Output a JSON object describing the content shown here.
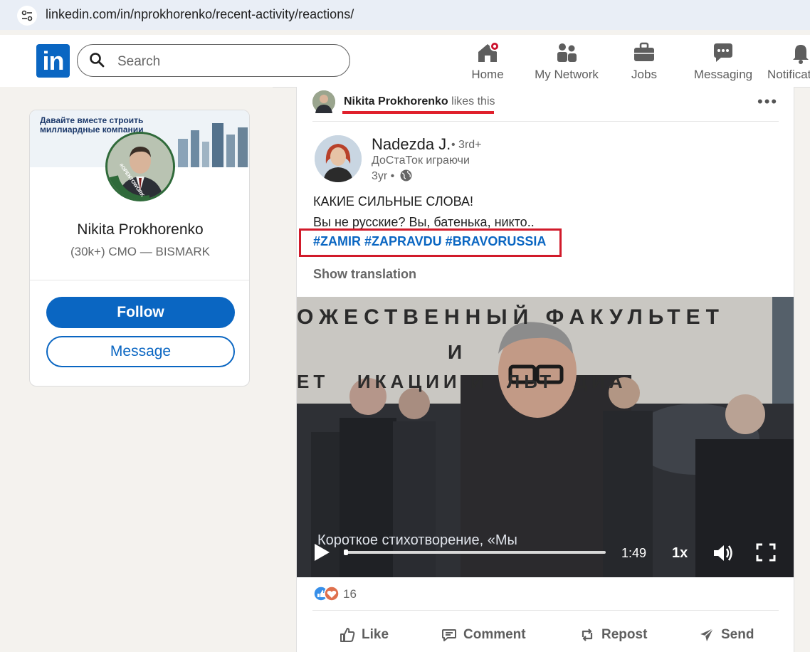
{
  "browser": {
    "url": "linkedin.com/in/nprokhorenko/recent-activity/reactions/"
  },
  "nav": {
    "logo": "in",
    "search_placeholder": "Search",
    "items": [
      {
        "label": "Home",
        "icon": "home-icon"
      },
      {
        "label": "My Network",
        "icon": "network-icon"
      },
      {
        "label": "Jobs",
        "icon": "briefcase-icon"
      },
      {
        "label": "Messaging",
        "icon": "messaging-icon"
      },
      {
        "label": "Notificat",
        "icon": "bell-icon"
      }
    ],
    "colors": {
      "brand": "#0a66c2",
      "notification_dot": "#cb112d"
    }
  },
  "profile": {
    "banner_text": "Давайте вместе строить миллиардные компании",
    "avatar_badge": "#OPENTOWORK",
    "name": "Nikita Prokhorenko",
    "headline": "(30k+) CMO — BISMARK",
    "follow_label": "Follow",
    "message_label": "Message"
  },
  "post": {
    "actor_name": "Nikita Prokhorenko",
    "actor_action": "likes this",
    "author_name": "Nadezda J.",
    "author_degree": "• 3rd+",
    "author_headline": "ДоСтаТок играючи",
    "timestamp": "3yr •",
    "text_line1": "КАКИЕ СИЛЬНЫЕ СЛОВА!",
    "text_line2": "Вы не русские? Вы, батенька, никто..",
    "hashtags": "#ZAMIR #ZAPRAVDU #BRAVORUSSIA",
    "show_translation": "Show translation",
    "video": {
      "sign_line1": "ОЖЕСТВЕННЫЙ ФАКУЛЬТЕТ",
      "sign_line2": "И",
      "sign_line3": "ЕТ   ИКАЦИИ И  ЛЬТ  ДИА",
      "caption": "Короткое стихотворение, «Мы",
      "duration": "1:49",
      "speed": "1x",
      "progress_fraction": 0.0
    },
    "reaction_count": "16",
    "actions": [
      {
        "label": "Like",
        "icon": "like-icon"
      },
      {
        "label": "Comment",
        "icon": "comment-icon"
      },
      {
        "label": "Repost",
        "icon": "repost-icon"
      },
      {
        "label": "Send",
        "icon": "send-icon"
      }
    ],
    "annotation_color": "#d11a2a"
  }
}
